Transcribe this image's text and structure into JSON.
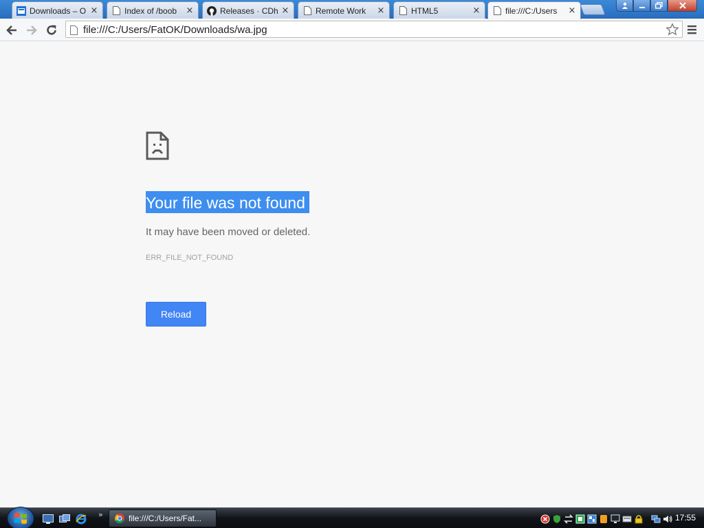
{
  "browser": {
    "tabs": [
      {
        "title": "Downloads – O",
        "favicon": "sharepoint-icon",
        "active": false
      },
      {
        "title": "Index of /boob",
        "favicon": "page-icon",
        "active": false
      },
      {
        "title": "Releases · CDh",
        "favicon": "github-icon",
        "active": false
      },
      {
        "title": "Remote Work",
        "favicon": "page-icon",
        "active": false
      },
      {
        "title": "HTML5",
        "favicon": "page-icon",
        "active": false
      },
      {
        "title": "file:///C:/Users",
        "favicon": "page-icon",
        "active": true
      }
    ],
    "tab_close_glyph": "×",
    "url": "file:///C:/Users/FatOK/Downloads/wa.jpg"
  },
  "error_page": {
    "title": "Your file was not found",
    "subtitle": "It may have been moved or deleted.",
    "code": "ERR_FILE_NOT_FOUND",
    "reload_label": "Reload",
    "accent_color": "#4285f4",
    "selection_color": "#3d8eef"
  },
  "taskbar": {
    "quicklaunch_chevron": "»",
    "task_label": "file:///C:/Users/Fat...",
    "clock": "17:55"
  }
}
